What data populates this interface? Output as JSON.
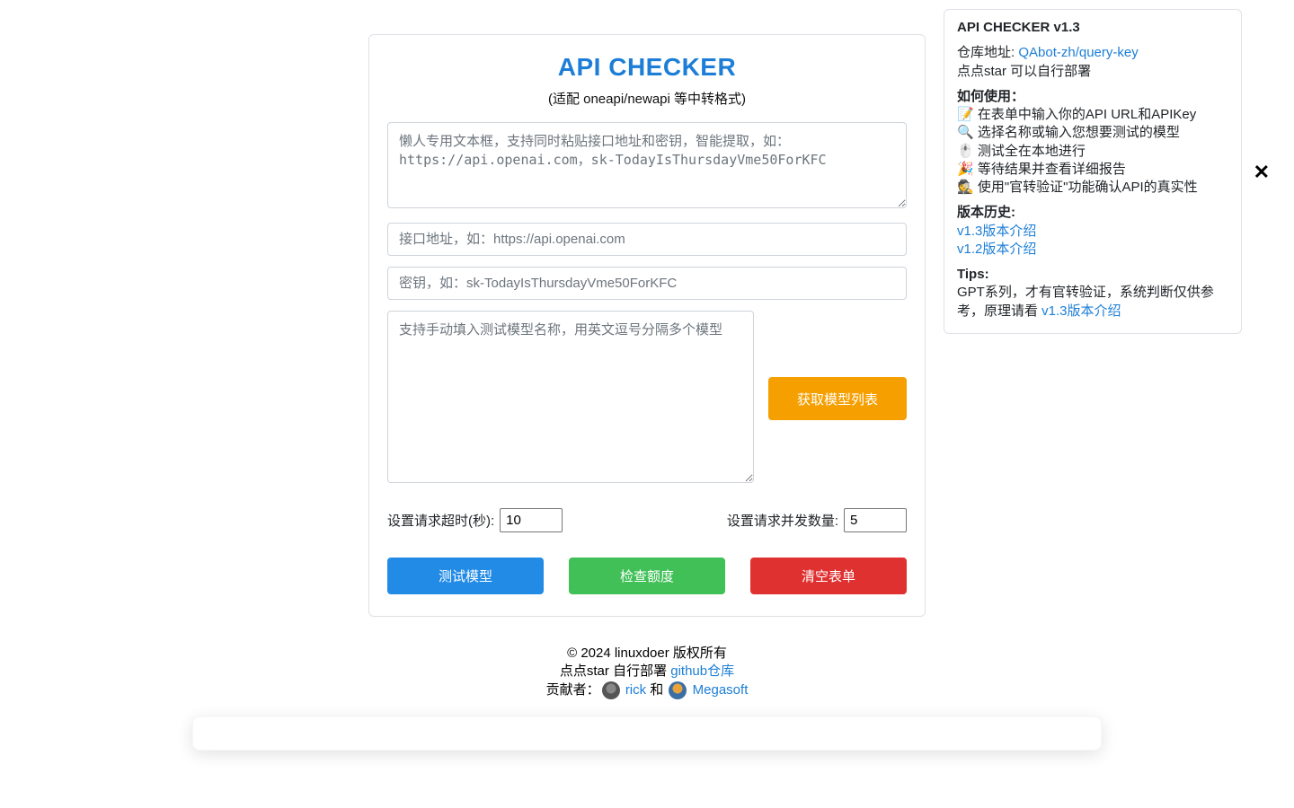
{
  "header": {
    "title": "API CHECKER",
    "subtitle": "(适配 oneapi/newapi 等中转格式)"
  },
  "form": {
    "lazy_placeholder": "懒人专用文本框，支持同时粘贴接口地址和密钥，智能提取，如：https://api.openai.com，sk-TodayIsThursdayVme50ForKFC",
    "url_placeholder": "接口地址，如：https://api.openai.com",
    "key_placeholder": "密钥，如：sk-TodayIsThursdayVme50ForKFC",
    "models_placeholder": "支持手动填入测试模型名称，用英文逗号分隔多个模型",
    "fetch_models_btn": "获取模型列表",
    "timeout_label": "设置请求超时(秒):",
    "timeout_value": "10",
    "concurrency_label": "设置请求并发数量:",
    "concurrency_value": "5",
    "btn_test": "测试模型",
    "btn_quota": "检查额度",
    "btn_clear": "清空表单"
  },
  "footer": {
    "copyright": "© 2024 linuxdoer 版权所有",
    "star_prefix": "点点star 自行部署 ",
    "repo_link": "github仓库",
    "contrib_prefix": "贡献者：",
    "contrib1": "rick",
    "contrib_conj": " 和 ",
    "contrib2": "Megasoft"
  },
  "panel": {
    "heading": "API CHECKER v1.3",
    "repo_label": "仓库地址: ",
    "repo_link": "QAbot-zh/query-key",
    "star_note": "点点star 可以自行部署",
    "howto_title": "如何使用：",
    "howto": [
      "📝 在表单中输入你的API URL和APIKey",
      "🔍 选择名称或输入您想要测试的模型",
      "🖱️ 测试全在本地进行",
      "🎉 等待结果并查看详细报告",
      "🕵️ 使用\"官转验证\"功能确认API的真实性"
    ],
    "history_title": "版本历史:",
    "history": [
      "v1.3版本介绍",
      "v1.2版本介绍"
    ],
    "tips_title": "Tips:",
    "tips_text_a": "GPT系列，才有官转验证，系统判断仅供参考，原理请看 ",
    "tips_link": "v1.3版本介绍"
  }
}
